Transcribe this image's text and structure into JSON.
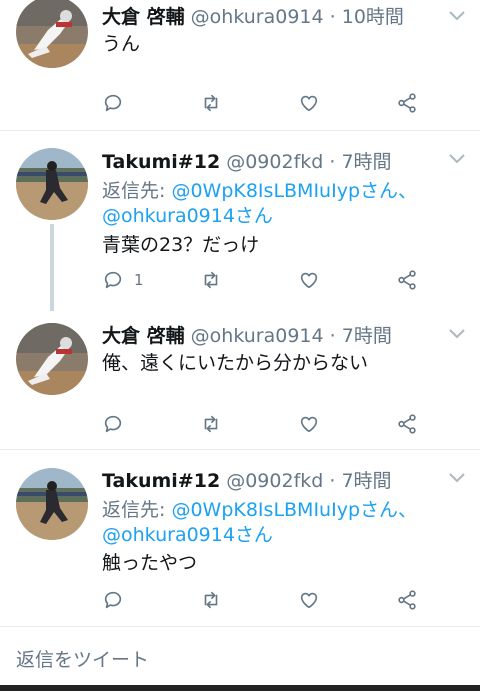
{
  "tweets": [
    {
      "name": "大倉 啓輔",
      "handle": "@ohkura0914",
      "time": "10時間",
      "reply_prefix": "",
      "reply_to_1": "",
      "reply_to_2": "",
      "text": "うん",
      "reply_count": "",
      "avatar": "pitcher"
    },
    {
      "name": "Takumi#12",
      "handle": "@0902fkd",
      "time": "7時間",
      "reply_prefix": "返信先: ",
      "reply_to_1": "@0WpK8IsLBMIuIypさん、",
      "reply_to_2": "@ohkura0914さん",
      "text": "青葉の23？だっけ",
      "reply_count": "1",
      "avatar": "batter"
    },
    {
      "name": "大倉 啓輔",
      "handle": "@ohkura0914",
      "time": "7時間",
      "reply_prefix": "",
      "reply_to_1": "",
      "reply_to_2": "",
      "text": "俺、遠くにいたから分からない",
      "reply_count": "",
      "avatar": "pitcher"
    },
    {
      "name": "Takumi#12",
      "handle": "@0902fkd",
      "time": "7時間",
      "reply_prefix": "返信先: ",
      "reply_to_1": "@0WpK8IsLBMIuIypさん、",
      "reply_to_2": "@ohkura0914さん",
      "text": "触ったやつ",
      "reply_count": "",
      "avatar": "batter"
    }
  ],
  "meta_separator": " · ",
  "compose": {
    "placeholder": "返信をツイート"
  },
  "icons": {
    "reply": "reply-icon",
    "retweet": "retweet-icon",
    "like": "like-icon",
    "share": "share-icon",
    "caret": "chevron-down-icon"
  },
  "colors": {
    "link": "#1da1f2",
    "secondary_text": "#657786",
    "divider": "#e6ecf0",
    "thread_line": "#ccd6dd"
  }
}
